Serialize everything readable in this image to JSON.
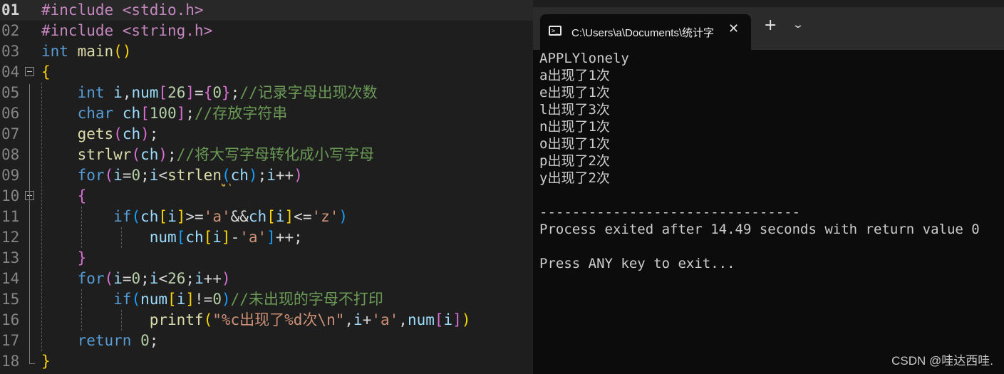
{
  "editor": {
    "line_numbers": [
      "01",
      "02",
      "03",
      "04",
      "05",
      "06",
      "07",
      "08",
      "09",
      "10",
      "11",
      "12",
      "13",
      "14",
      "15",
      "16",
      "17",
      "18"
    ],
    "lines": [
      [
        [
          "#include <stdio.h>",
          "pp"
        ]
      ],
      [
        [
          "#include <string.h>",
          "pp"
        ]
      ],
      [
        [
          "int",
          "kw"
        ],
        [
          " ",
          "op"
        ],
        [
          "main",
          "fn"
        ],
        [
          "()",
          "br"
        ]
      ],
      [
        [
          "{",
          "br"
        ]
      ],
      [
        [
          "    ",
          "op"
        ],
        [
          "int",
          "kw"
        ],
        [
          " ",
          "op"
        ],
        [
          "i",
          "var"
        ],
        [
          ",",
          "op"
        ],
        [
          "num",
          "var"
        ],
        [
          "[",
          "br2"
        ],
        [
          "26",
          "num"
        ],
        [
          "]",
          "br2"
        ],
        [
          "=",
          "op"
        ],
        [
          "{",
          "br2"
        ],
        [
          "0",
          "num"
        ],
        [
          "}",
          "br2"
        ],
        [
          ";",
          "op"
        ],
        [
          "//记录字母出现次数",
          "cm"
        ]
      ],
      [
        [
          "    ",
          "op"
        ],
        [
          "char",
          "kw"
        ],
        [
          " ",
          "op"
        ],
        [
          "ch",
          "var"
        ],
        [
          "[",
          "br2"
        ],
        [
          "100",
          "num"
        ],
        [
          "]",
          "br2"
        ],
        [
          ";",
          "op"
        ],
        [
          "//存放字符串",
          "cm"
        ]
      ],
      [
        [
          "    ",
          "op"
        ],
        [
          "gets",
          "fn"
        ],
        [
          "(",
          "br2"
        ],
        [
          "ch",
          "var"
        ],
        [
          ")",
          "br2"
        ],
        [
          ";",
          "op"
        ]
      ],
      [
        [
          "    ",
          "op"
        ],
        [
          "strlwr",
          "fn"
        ],
        [
          "(",
          "br2"
        ],
        [
          "ch",
          "var"
        ],
        [
          ")",
          "br2"
        ],
        [
          ";",
          "op"
        ],
        [
          "//将大写字母转化成小写字母",
          "cm"
        ]
      ],
      [
        [
          "    ",
          "op"
        ],
        [
          "for",
          "kw"
        ],
        [
          "(",
          "br2"
        ],
        [
          "i",
          "var"
        ],
        [
          "=",
          "op"
        ],
        [
          "0",
          "num"
        ],
        [
          ";",
          "op"
        ],
        [
          "i",
          "var"
        ],
        [
          "<",
          "op"
        ],
        [
          "strlen",
          "fn"
        ],
        [
          "(",
          "br3"
        ],
        [
          "ch",
          "var"
        ],
        [
          ")",
          "br3"
        ],
        [
          ";",
          "op"
        ],
        [
          "i",
          "var"
        ],
        [
          "++",
          "op"
        ],
        [
          ")",
          "br2"
        ]
      ],
      [
        [
          "    ",
          "op"
        ],
        [
          "{",
          "br2"
        ]
      ],
      [
        [
          "        ",
          "op"
        ],
        [
          "if",
          "kw"
        ],
        [
          "(",
          "br3"
        ],
        [
          "ch",
          "var"
        ],
        [
          "[",
          "br"
        ],
        [
          "i",
          "var"
        ],
        [
          "]",
          "br"
        ],
        [
          ">=",
          "op"
        ],
        [
          "'a'",
          "str"
        ],
        [
          "&&",
          "op"
        ],
        [
          "ch",
          "var"
        ],
        [
          "[",
          "br"
        ],
        [
          "i",
          "var"
        ],
        [
          "]",
          "br"
        ],
        [
          "<=",
          "op"
        ],
        [
          "'z'",
          "str"
        ],
        [
          ")",
          "br3"
        ]
      ],
      [
        [
          "            ",
          "op"
        ],
        [
          "num",
          "var"
        ],
        [
          "[",
          "br3"
        ],
        [
          "ch",
          "var"
        ],
        [
          "[",
          "br"
        ],
        [
          "i",
          "var"
        ],
        [
          "]",
          "br"
        ],
        [
          "-",
          "op"
        ],
        [
          "'a'",
          "str"
        ],
        [
          "]",
          "br3"
        ],
        [
          "++;",
          "op"
        ]
      ],
      [
        [
          "    ",
          "op"
        ],
        [
          "}",
          "br2"
        ]
      ],
      [
        [
          "    ",
          "op"
        ],
        [
          "for",
          "kw"
        ],
        [
          "(",
          "br2"
        ],
        [
          "i",
          "var"
        ],
        [
          "=",
          "op"
        ],
        [
          "0",
          "num"
        ],
        [
          ";",
          "op"
        ],
        [
          "i",
          "var"
        ],
        [
          "<",
          "op"
        ],
        [
          "26",
          "num"
        ],
        [
          ";",
          "op"
        ],
        [
          "i",
          "var"
        ],
        [
          "++",
          "op"
        ],
        [
          ")",
          "br2"
        ]
      ],
      [
        [
          "        ",
          "op"
        ],
        [
          "if",
          "kw"
        ],
        [
          "(",
          "br3"
        ],
        [
          "num",
          "var"
        ],
        [
          "[",
          "br"
        ],
        [
          "i",
          "var"
        ],
        [
          "]",
          "br"
        ],
        [
          "!=",
          "op"
        ],
        [
          "0",
          "num"
        ],
        [
          ")",
          "br3"
        ],
        [
          "//未出现的字母不打印",
          "cm"
        ]
      ],
      [
        [
          "            ",
          "op"
        ],
        [
          "printf",
          "fn"
        ],
        [
          "(",
          "br"
        ],
        [
          "\"%c出现了%d次\\n\"",
          "str"
        ],
        [
          ",",
          "op"
        ],
        [
          "i",
          "var"
        ],
        [
          "+",
          "op"
        ],
        [
          "'a'",
          "str"
        ],
        [
          ",",
          "op"
        ],
        [
          "num",
          "var"
        ],
        [
          "[",
          "br2"
        ],
        [
          "i",
          "var"
        ],
        [
          "]",
          "br2"
        ],
        [
          ")",
          "br"
        ]
      ],
      [
        [
          "    ",
          "op"
        ],
        [
          "return",
          "kw"
        ],
        [
          " ",
          "op"
        ],
        [
          "0",
          "num"
        ],
        [
          ";",
          "op"
        ]
      ],
      [
        [
          "}",
          "br"
        ]
      ]
    ]
  },
  "terminal": {
    "tab_title": "C:\\Users\\a\\Documents\\统计字",
    "tab_icon_glyph": ">_",
    "close_glyph": "✕",
    "new_tab_glyph": "+",
    "dropdown_glyph": "⌄",
    "output_lines": [
      "APPLYlonely",
      "a出现了1次",
      "e出现了1次",
      "l出现了3次",
      "n出现了1次",
      "o出现了1次",
      "p出现了2次",
      "y出现了2次",
      "",
      "--------------------------------",
      "Process exited after 14.49 seconds with return value 0",
      "",
      "Press ANY key to exit..."
    ]
  },
  "watermark": "CSDN @哇达西哇."
}
